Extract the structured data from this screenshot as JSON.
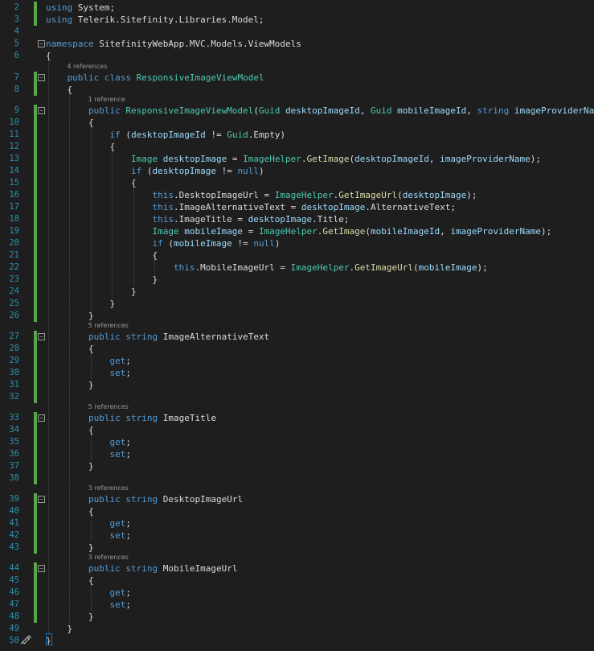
{
  "editor": {
    "lines": [
      {
        "n": "2",
        "tokens": [
          [
            "kw",
            "using"
          ],
          [
            "pl",
            " System;"
          ]
        ]
      },
      {
        "n": "3",
        "tokens": [
          [
            "kw",
            "using"
          ],
          [
            "pl",
            " Telerik.Sitefinity.Libraries.Model;"
          ]
        ]
      },
      {
        "n": "4",
        "tokens": []
      },
      {
        "n": "5",
        "tokens": [
          [
            "kw",
            "namespace"
          ],
          [
            "pl",
            " SitefinityWebApp.MVC.Models.ViewModels"
          ]
        ]
      },
      {
        "n": "6",
        "tokens": [
          [
            "pl",
            "{"
          ]
        ]
      },
      {
        "n": "7",
        "tokens": [
          [
            "pl",
            "    "
          ],
          [
            "kw",
            "public"
          ],
          [
            "pl",
            " "
          ],
          [
            "kw",
            "class"
          ],
          [
            "pl",
            " "
          ],
          [
            "ty",
            "ResponsiveImageViewModel"
          ]
        ]
      },
      {
        "n": "8",
        "tokens": [
          [
            "pl",
            "    {"
          ]
        ]
      },
      {
        "n": "9",
        "tokens": [
          [
            "pl",
            "        "
          ],
          [
            "kw",
            "public"
          ],
          [
            "pl",
            " "
          ],
          [
            "ty",
            "ResponsiveImageViewModel"
          ],
          [
            "pl",
            "("
          ],
          [
            "ty",
            "Guid"
          ],
          [
            "pl",
            " "
          ],
          [
            "lc",
            "desktopImageId"
          ],
          [
            "pl",
            ", "
          ],
          [
            "ty",
            "Guid"
          ],
          [
            "pl",
            " "
          ],
          [
            "lc",
            "mobileImageId"
          ],
          [
            "pl",
            ", "
          ],
          [
            "kw",
            "string"
          ],
          [
            "pl",
            " "
          ],
          [
            "lc",
            "imageProviderName"
          ],
          [
            "pl",
            ")"
          ]
        ]
      },
      {
        "n": "10",
        "tokens": [
          [
            "pl",
            "        {"
          ]
        ]
      },
      {
        "n": "11",
        "tokens": [
          [
            "pl",
            "            "
          ],
          [
            "kw",
            "if"
          ],
          [
            "pl",
            " ("
          ],
          [
            "lc",
            "desktopImageId"
          ],
          [
            "pl",
            " != "
          ],
          [
            "ty",
            "Guid"
          ],
          [
            "pl",
            ".Empty)"
          ]
        ]
      },
      {
        "n": "12",
        "tokens": [
          [
            "pl",
            "            {"
          ]
        ]
      },
      {
        "n": "13",
        "tokens": [
          [
            "pl",
            "                "
          ],
          [
            "ty",
            "Image"
          ],
          [
            "pl",
            " "
          ],
          [
            "lc",
            "desktopImage"
          ],
          [
            "pl",
            " = "
          ],
          [
            "ty",
            "ImageHelper"
          ],
          [
            "pl",
            "."
          ],
          [
            "fn",
            "GetImage"
          ],
          [
            "pl",
            "("
          ],
          [
            "lc",
            "desktopImageId"
          ],
          [
            "pl",
            ", "
          ],
          [
            "lc",
            "imageProviderName"
          ],
          [
            "pl",
            ");"
          ]
        ]
      },
      {
        "n": "14",
        "tokens": [
          [
            "pl",
            "                "
          ],
          [
            "kw",
            "if"
          ],
          [
            "pl",
            " ("
          ],
          [
            "lc",
            "desktopImage"
          ],
          [
            "pl",
            " != "
          ],
          [
            "kw",
            "null"
          ],
          [
            "pl",
            ")"
          ]
        ]
      },
      {
        "n": "15",
        "tokens": [
          [
            "pl",
            "                {"
          ]
        ]
      },
      {
        "n": "16",
        "tokens": [
          [
            "pl",
            "                    "
          ],
          [
            "kw",
            "this"
          ],
          [
            "pl",
            ".DesktopImageUrl = "
          ],
          [
            "ty",
            "ImageHelper"
          ],
          [
            "pl",
            "."
          ],
          [
            "fn",
            "GetImageUrl"
          ],
          [
            "pl",
            "("
          ],
          [
            "lc",
            "desktopImage"
          ],
          [
            "pl",
            ");"
          ]
        ]
      },
      {
        "n": "17",
        "tokens": [
          [
            "pl",
            "                    "
          ],
          [
            "kw",
            "this"
          ],
          [
            "pl",
            ".ImageAlternativeText = "
          ],
          [
            "lc",
            "desktopImage"
          ],
          [
            "pl",
            ".AlternativeText;"
          ]
        ]
      },
      {
        "n": "18",
        "tokens": [
          [
            "pl",
            "                    "
          ],
          [
            "kw",
            "this"
          ],
          [
            "pl",
            ".ImageTitle = "
          ],
          [
            "lc",
            "desktopImage"
          ],
          [
            "pl",
            ".Title;"
          ]
        ]
      },
      {
        "n": "19",
        "tokens": [
          [
            "pl",
            "                    "
          ],
          [
            "ty",
            "Image"
          ],
          [
            "pl",
            " "
          ],
          [
            "lc",
            "mobileImage"
          ],
          [
            "pl",
            " = "
          ],
          [
            "ty",
            "ImageHelper"
          ],
          [
            "pl",
            "."
          ],
          [
            "fn",
            "GetImage"
          ],
          [
            "pl",
            "("
          ],
          [
            "lc",
            "mobileImageId"
          ],
          [
            "pl",
            ", "
          ],
          [
            "lc",
            "imageProviderName"
          ],
          [
            "pl",
            ");"
          ]
        ]
      },
      {
        "n": "20",
        "tokens": [
          [
            "pl",
            "                    "
          ],
          [
            "kw",
            "if"
          ],
          [
            "pl",
            " ("
          ],
          [
            "lc",
            "mobileImage"
          ],
          [
            "pl",
            " != "
          ],
          [
            "kw",
            "null"
          ],
          [
            "pl",
            ")"
          ]
        ]
      },
      {
        "n": "21",
        "tokens": [
          [
            "pl",
            "                    {"
          ]
        ]
      },
      {
        "n": "22",
        "tokens": [
          [
            "pl",
            "                        "
          ],
          [
            "kw",
            "this"
          ],
          [
            "pl",
            ".MobileImageUrl = "
          ],
          [
            "ty",
            "ImageHelper"
          ],
          [
            "pl",
            "."
          ],
          [
            "fn",
            "GetImageUrl"
          ],
          [
            "pl",
            "("
          ],
          [
            "lc",
            "mobileImage"
          ],
          [
            "pl",
            ");"
          ]
        ]
      },
      {
        "n": "23",
        "tokens": [
          [
            "pl",
            "                    }"
          ]
        ]
      },
      {
        "n": "24",
        "tokens": [
          [
            "pl",
            "                }"
          ]
        ]
      },
      {
        "n": "25",
        "tokens": [
          [
            "pl",
            "            }"
          ]
        ]
      },
      {
        "n": "26",
        "tokens": [
          [
            "pl",
            "        }"
          ]
        ]
      },
      {
        "n": "27",
        "tokens": [
          [
            "pl",
            "        "
          ],
          [
            "kw",
            "public"
          ],
          [
            "pl",
            " "
          ],
          [
            "kw",
            "string"
          ],
          [
            "pl",
            " ImageAlternativeText"
          ]
        ]
      },
      {
        "n": "28",
        "tokens": [
          [
            "pl",
            "        {"
          ]
        ]
      },
      {
        "n": "29",
        "tokens": [
          [
            "pl",
            "            "
          ],
          [
            "kw",
            "get"
          ],
          [
            "pl",
            ";"
          ]
        ]
      },
      {
        "n": "30",
        "tokens": [
          [
            "pl",
            "            "
          ],
          [
            "kw",
            "set"
          ],
          [
            "pl",
            ";"
          ]
        ]
      },
      {
        "n": "31",
        "tokens": [
          [
            "pl",
            "        }"
          ]
        ]
      },
      {
        "n": "32",
        "tokens": []
      },
      {
        "n": "33",
        "tokens": [
          [
            "pl",
            "        "
          ],
          [
            "kw",
            "public"
          ],
          [
            "pl",
            " "
          ],
          [
            "kw",
            "string"
          ],
          [
            "pl",
            " ImageTitle"
          ]
        ]
      },
      {
        "n": "34",
        "tokens": [
          [
            "pl",
            "        {"
          ]
        ]
      },
      {
        "n": "35",
        "tokens": [
          [
            "pl",
            "            "
          ],
          [
            "kw",
            "get"
          ],
          [
            "pl",
            ";"
          ]
        ]
      },
      {
        "n": "36",
        "tokens": [
          [
            "pl",
            "            "
          ],
          [
            "kw",
            "set"
          ],
          [
            "pl",
            ";"
          ]
        ]
      },
      {
        "n": "37",
        "tokens": [
          [
            "pl",
            "        }"
          ]
        ]
      },
      {
        "n": "38",
        "tokens": []
      },
      {
        "n": "39",
        "tokens": [
          [
            "pl",
            "        "
          ],
          [
            "kw",
            "public"
          ],
          [
            "pl",
            " "
          ],
          [
            "kw",
            "string"
          ],
          [
            "pl",
            " DesktopImageUrl"
          ]
        ]
      },
      {
        "n": "40",
        "tokens": [
          [
            "pl",
            "        {"
          ]
        ]
      },
      {
        "n": "41",
        "tokens": [
          [
            "pl",
            "            "
          ],
          [
            "kw",
            "get"
          ],
          [
            "pl",
            ";"
          ]
        ]
      },
      {
        "n": "42",
        "tokens": [
          [
            "pl",
            "            "
          ],
          [
            "kw",
            "set"
          ],
          [
            "pl",
            ";"
          ]
        ]
      },
      {
        "n": "43",
        "tokens": [
          [
            "pl",
            "        }"
          ]
        ]
      },
      {
        "n": "44",
        "tokens": [
          [
            "pl",
            "        "
          ],
          [
            "kw",
            "public"
          ],
          [
            "pl",
            " "
          ],
          [
            "kw",
            "string"
          ],
          [
            "pl",
            " MobileImageUrl"
          ]
        ]
      },
      {
        "n": "45",
        "tokens": [
          [
            "pl",
            "        {"
          ]
        ]
      },
      {
        "n": "46",
        "tokens": [
          [
            "pl",
            "            "
          ],
          [
            "kw",
            "get"
          ],
          [
            "pl",
            ";"
          ]
        ]
      },
      {
        "n": "47",
        "tokens": [
          [
            "pl",
            "            "
          ],
          [
            "kw",
            "set"
          ],
          [
            "pl",
            ";"
          ]
        ]
      },
      {
        "n": "48",
        "tokens": [
          [
            "pl",
            "        }"
          ]
        ]
      },
      {
        "n": "49",
        "tokens": [
          [
            "pl",
            "    }"
          ]
        ]
      },
      {
        "n": "50",
        "tokens": [
          [
            "pl",
            "}"
          ]
        ]
      }
    ],
    "codelens": [
      {
        "before": "7",
        "text": "4 references"
      },
      {
        "before": "9",
        "text": "1 reference"
      },
      {
        "before": "27",
        "text": "5 references"
      },
      {
        "before": "33",
        "text": "5 references"
      },
      {
        "before": "39",
        "text": "3 references"
      },
      {
        "before": "44",
        "text": "3 references"
      }
    ]
  },
  "colors": {
    "background": "#1e1e1e",
    "keyword": "#569cd6",
    "type": "#4ec9b0",
    "method": "#dcdcaa",
    "local": "#9cdcfe",
    "line_number": "#2b91af",
    "changed_marker": "#57a64a"
  },
  "icons": {
    "fold_toggle": "minus-box-icon",
    "status_tool": "paint-brush-icon"
  }
}
